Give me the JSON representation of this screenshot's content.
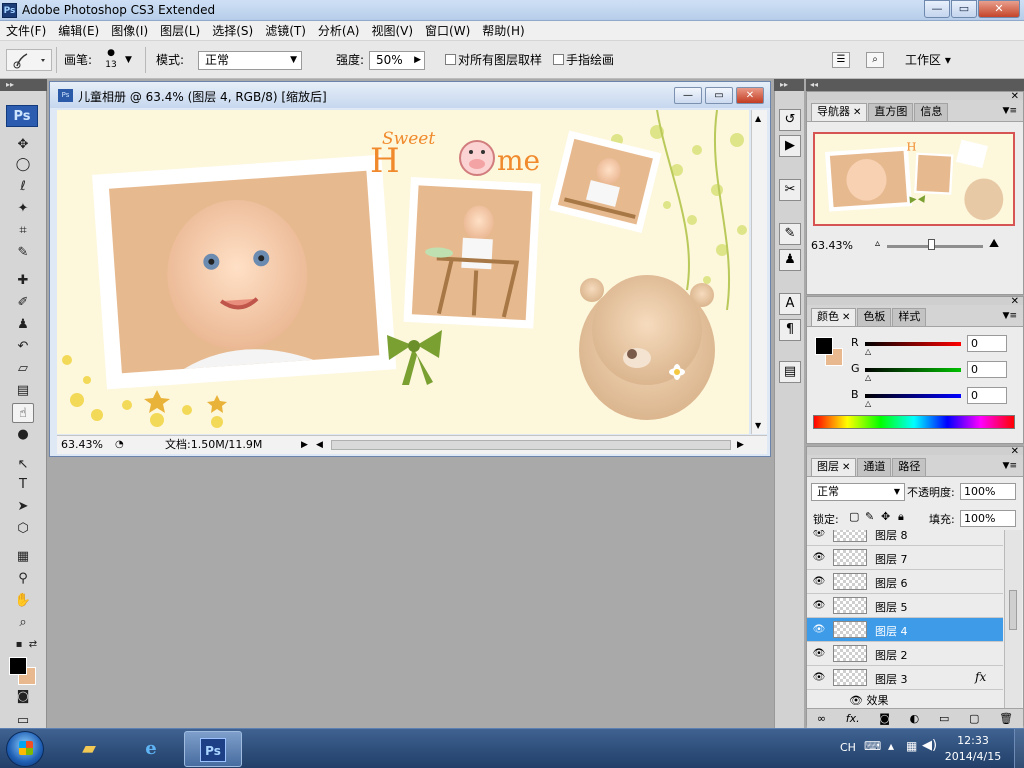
{
  "app": {
    "title": "Adobe Photoshop CS3 Extended",
    "badge": "Ps",
    "controls": {
      "minimize": "—",
      "maximize": "▭",
      "close": "✕"
    }
  },
  "menu": {
    "items": [
      "文件(F)",
      "编辑(E)",
      "图像(I)",
      "图层(L)",
      "选择(S)",
      "滤镜(T)",
      "分析(A)",
      "视图(V)",
      "窗口(W)",
      "帮助(H)"
    ]
  },
  "options": {
    "brush_label": "画笔:",
    "brush_size": "13",
    "mode_label": "模式:",
    "mode_value": "正常",
    "strength_label": "强度:",
    "strength_value": "50%",
    "sample_all_label": "对所有图层取样",
    "finger_paint_label": "手指绘画",
    "workspace_label": "工作区 ▾"
  },
  "tools": {
    "logo": "Ps",
    "list": [
      {
        "name": "move-tool-icon",
        "glyph": "✥"
      },
      {
        "name": "marquee-tool-icon",
        "glyph": "◯"
      },
      {
        "name": "lasso-tool-icon",
        "glyph": "ℓ"
      },
      {
        "name": "magic-wand-tool-icon",
        "glyph": "✦"
      },
      {
        "name": "crop-tool-icon",
        "glyph": "⌗"
      },
      {
        "name": "slice-tool-icon",
        "glyph": "✎"
      },
      {
        "name": "healing-brush-tool-icon",
        "glyph": "✚"
      },
      {
        "name": "brush-tool-icon",
        "glyph": "✐"
      },
      {
        "name": "clone-stamp-tool-icon",
        "glyph": "♟"
      },
      {
        "name": "history-brush-tool-icon",
        "glyph": "↶"
      },
      {
        "name": "eraser-tool-icon",
        "glyph": "▱"
      },
      {
        "name": "gradient-tool-icon",
        "glyph": "▤"
      },
      {
        "name": "smudge-tool-icon",
        "glyph": "☝"
      },
      {
        "name": "dodge-tool-icon",
        "glyph": "●"
      },
      {
        "name": "pen-tool-icon",
        "glyph": "↖"
      },
      {
        "name": "type-tool-icon",
        "glyph": "T"
      },
      {
        "name": "path-selection-tool-icon",
        "glyph": "➤"
      },
      {
        "name": "shape-tool-icon",
        "glyph": "⬡"
      },
      {
        "name": "notes-tool-icon",
        "glyph": "▦"
      },
      {
        "name": "eyedropper-tool-icon",
        "glyph": "⚲"
      },
      {
        "name": "hand-tool-icon",
        "glyph": "✋"
      },
      {
        "name": "zoom-tool-icon",
        "glyph": "⌕"
      }
    ],
    "fg_color": "#000000",
    "bg_color": "#e8b98e"
  },
  "document": {
    "title": "儿童相册 @ 63.4% (图层 4, RGB/8) [缩放后]",
    "zoom": "63.43%",
    "doc_size": "文档:1.50M/11.9M",
    "canvas_text": {
      "sweet": "Sweet",
      "home_h": "H",
      "home_me": "me"
    }
  },
  "navigator": {
    "tabs": [
      "导航器",
      "直方图",
      "信息"
    ],
    "zoom": "63.43%"
  },
  "color": {
    "tabs": [
      "颜色",
      "色板",
      "样式"
    ],
    "channels": [
      {
        "label": "R",
        "value": "0",
        "color": "#d81d1d"
      },
      {
        "label": "G",
        "value": "0",
        "color": "#1ea21e"
      },
      {
        "label": "B",
        "value": "0",
        "color": "#1d2fd8"
      }
    ]
  },
  "layers": {
    "tabs": [
      "图层",
      "通道",
      "路径"
    ],
    "blend_mode": "正常",
    "opacity_label": "不透明度:",
    "opacity": "100%",
    "lock_label": "锁定:",
    "fill_label": "填充:",
    "fill": "100%",
    "rows": [
      {
        "name": "图层 8",
        "selected": false,
        "fx": false
      },
      {
        "name": "图层 7",
        "selected": false,
        "fx": false
      },
      {
        "name": "图层 6",
        "selected": false,
        "fx": false
      },
      {
        "name": "图层 5",
        "selected": false,
        "fx": false
      },
      {
        "name": "图层 4",
        "selected": true,
        "fx": false
      },
      {
        "name": "图层 2",
        "selected": false,
        "fx": false
      },
      {
        "name": "图层 3",
        "selected": false,
        "fx": true
      }
    ],
    "effects_label": "效果",
    "fx_glyph": "fx"
  },
  "taskbar": {
    "ps_label": "Ps",
    "lang": "CH",
    "time": "12:33",
    "date": "2014/4/15"
  }
}
